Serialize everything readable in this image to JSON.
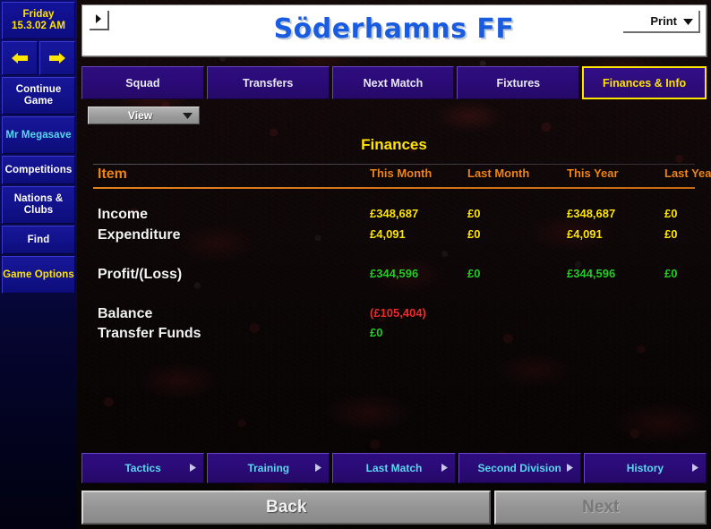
{
  "sidebar": {
    "date": {
      "day": "Friday",
      "stamp": "15.3.02 AM"
    },
    "nav_back_icon": "arrow-left-icon",
    "nav_forward_icon": "arrow-right-icon",
    "items": [
      {
        "label": "Continue Game",
        "line1": "Continue",
        "line2": "Game",
        "style": "white"
      },
      {
        "label": "Mr Megasave",
        "line1": "Mr",
        "line2": "Megasave",
        "style": "cyan"
      },
      {
        "label": "Competitions",
        "line1": "Competitions",
        "line2": "",
        "style": "white"
      },
      {
        "label": "Nations & Clubs",
        "line1": "Nations",
        "line2": "& Clubs",
        "style": "white"
      },
      {
        "label": "Find",
        "line1": "Find",
        "line2": "",
        "style": "white"
      },
      {
        "label": "Game Options",
        "line1": "Game",
        "line2": "Options",
        "style": "yellow"
      }
    ]
  },
  "header": {
    "club_title": "Söderhamns FF",
    "expand_icon": "triangle-right-icon",
    "print_label": "Print",
    "print_icon": "chevron-down-icon"
  },
  "tabs": [
    {
      "label": "Squad",
      "active": false
    },
    {
      "label": "Transfers",
      "active": false
    },
    {
      "label": "Next Match",
      "active": false
    },
    {
      "label": "Fixtures",
      "active": false
    },
    {
      "label": "Finances & Info",
      "active": true
    }
  ],
  "view_dropdown": {
    "label": "View",
    "icon": "chevron-down-icon"
  },
  "finances": {
    "title": "Finances",
    "columns": [
      "Item",
      "This Month",
      "Last Month",
      "This Year",
      "Last Year"
    ],
    "rows": [
      {
        "label": "Income",
        "values": [
          "£348,687",
          "£0",
          "£348,687",
          "£0"
        ],
        "color": "yellow"
      },
      {
        "label": "Expenditure",
        "values": [
          "£4,091",
          "£0",
          "£4,091",
          "£0"
        ],
        "color": "yellow"
      },
      {
        "label": "Profit/(Loss)",
        "values": [
          "£344,596",
          "£0",
          "£344,596",
          "£0"
        ],
        "color": "green"
      },
      {
        "label": "Balance",
        "values": [
          "(£105,404)",
          "",
          "",
          ""
        ],
        "color": "red"
      },
      {
        "label": "Transfer Funds",
        "values": [
          "£0",
          "",
          "",
          ""
        ],
        "color": "green"
      }
    ]
  },
  "bottom_nav": [
    {
      "label": "Tactics",
      "icon": "triangle-right-icon"
    },
    {
      "label": "Training",
      "icon": "triangle-right-icon"
    },
    {
      "label": "Last Match",
      "icon": "triangle-right-icon"
    },
    {
      "label": "Second Division",
      "icon": "triangle-right-icon"
    },
    {
      "label": "History",
      "icon": "triangle-right-icon"
    }
  ],
  "footer": {
    "back_label": "Back",
    "next_label": "Next"
  },
  "colors": {
    "accent_yellow": "#ffe400",
    "accent_orange": "#f08414",
    "positive_green": "#22cc22",
    "negative_red": "#ee2b2b",
    "tab_purple": "#2e0d7e",
    "title_blue": "#1a5ce0",
    "link_cyan": "#58d8ee"
  }
}
